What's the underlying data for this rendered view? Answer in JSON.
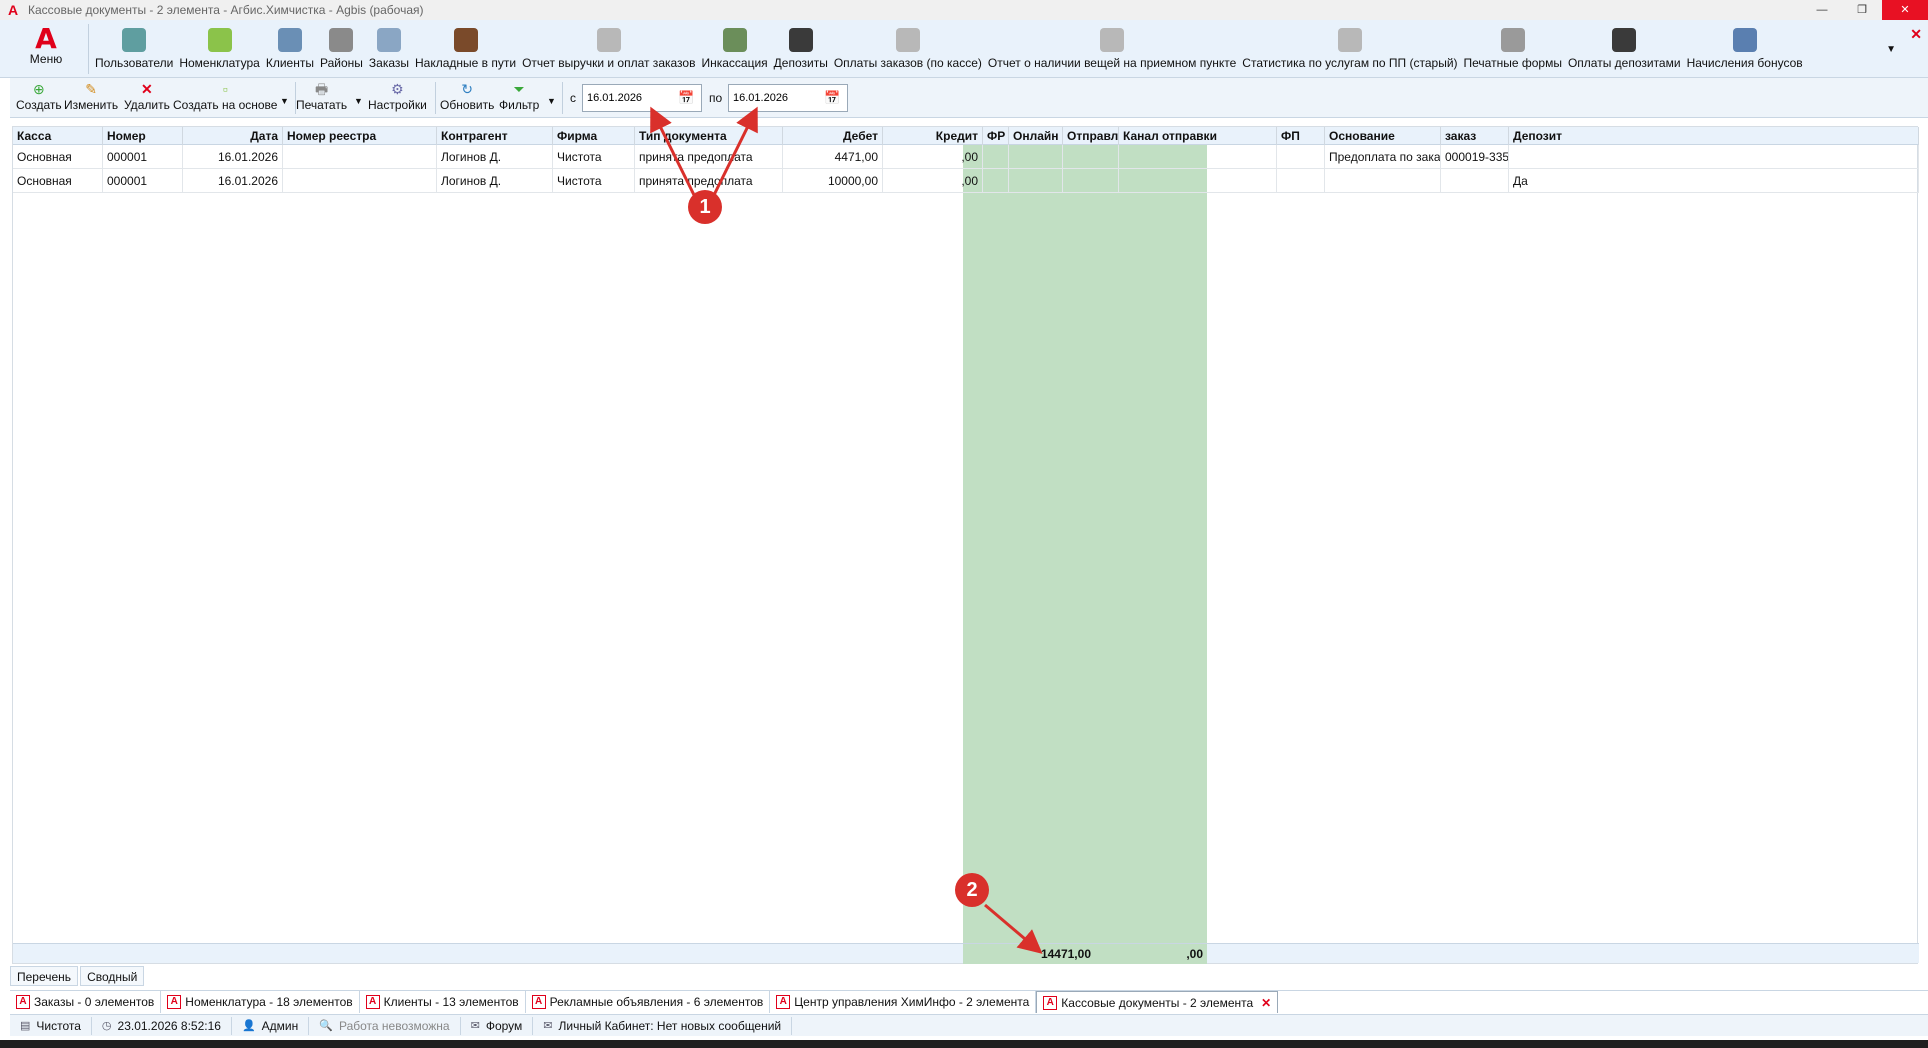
{
  "window": {
    "title": "Кассовые документы - 2 элемента - Агбис.Химчистка - Agbis (рабочая)"
  },
  "ribbon": {
    "menu_label": "Меню",
    "items": [
      {
        "label": "Пользователи",
        "icon": "users-icon",
        "color": "#5f9ea0"
      },
      {
        "label": "Номенклатура",
        "icon": "basket-icon",
        "color": "#8bc34a"
      },
      {
        "label": "Клиенты",
        "icon": "client-icon",
        "color": "#6a8fb5"
      },
      {
        "label": "Районы",
        "icon": "building-icon",
        "color": "#8a8a8a"
      },
      {
        "label": "Заказы",
        "icon": "orders-icon",
        "color": "#8aa6c4"
      },
      {
        "label": "Накладные в пути",
        "icon": "truck-icon",
        "color": "#7a4a2a"
      },
      {
        "label": "Отчет выручки и оплат заказов",
        "icon": "report-icon",
        "color": "#b8b8b8"
      },
      {
        "label": "Инкассация",
        "icon": "money-icon",
        "color": "#6b8e5a"
      },
      {
        "label": "Депозиты",
        "icon": "deposit-icon",
        "color": "#3a3a3a"
      },
      {
        "label": "Оплаты заказов (по кассе)",
        "icon": "report-icon",
        "color": "#b8b8b8"
      },
      {
        "label": "Отчет о наличии вещей на приемном пункте",
        "icon": "report-icon",
        "color": "#b8b8b8"
      },
      {
        "label": "Статистика по услугам по ПП (старый)",
        "icon": "report-icon",
        "color": "#b8b8b8"
      },
      {
        "label": "Печатные формы",
        "icon": "printer-icon",
        "color": "#9a9a9a"
      },
      {
        "label": "Оплаты депозитами",
        "icon": "deposit-icon",
        "color": "#3a3a3a"
      },
      {
        "label": "Начисления бонусов",
        "icon": "gift-icon",
        "color": "#5a7fb0"
      }
    ]
  },
  "toolbar": {
    "create": "Создать",
    "edit": "Изменить",
    "delete": "Удалить",
    "create_based": "Создать на основе",
    "print": "Печатать",
    "settings": "Настройки",
    "refresh": "Обновить",
    "filter": "Фильтр",
    "from_label": "с",
    "to_label": "по",
    "date_from": "16.01.2026",
    "date_to": "16.01.2026"
  },
  "grid": {
    "columns": [
      "Касса",
      "Номер",
      "Дата",
      "Номер реестра",
      "Контрагент",
      "Фирма",
      "Тип документа",
      "Дебет",
      "Кредит",
      "ФР",
      "Онлайн",
      "Отправл...",
      "Канал отправки",
      "ФП",
      "Основание",
      "заказ",
      "Депозит"
    ],
    "rows": [
      [
        "Основная",
        "000001",
        "16.01.2026",
        "",
        "Логинов Д.",
        "Чистота",
        "принята предоплата",
        "4471,00",
        ",00",
        "",
        "",
        "",
        "",
        "",
        "Предоплата по заказу",
        "000019-335",
        ""
      ],
      [
        "Основная",
        "000001",
        "16.01.2026",
        "",
        "Логинов Д.",
        "Чистота",
        "принята предоплата",
        "10000,00",
        ",00",
        "",
        "",
        "",
        "",
        "",
        "",
        "",
        "Да"
      ]
    ],
    "totals": {
      "debit": "14471,00",
      "credit": ",00"
    },
    "debit_highlight_color": "#c1dfc3"
  },
  "view_tabs": [
    "Перечень",
    "Сводный"
  ],
  "doc_tabs": [
    {
      "label": "Заказы - 0 элементов"
    },
    {
      "label": "Номенклатура - 18 элементов"
    },
    {
      "label": "Клиенты - 13 элементов"
    },
    {
      "label": "Рекламные объявления - 6 элементов"
    },
    {
      "label": "Центр управления ХимИнфо - 2 элемента"
    },
    {
      "label": "Кассовые документы - 2 элемента"
    }
  ],
  "status": {
    "firm": "Чистота",
    "datetime": "23.01.2026 8:52:16",
    "user": "Админ",
    "work_state": "Работа невозможна",
    "forum": "Форум",
    "cabinet": "Личный Кабинет: Нет новых сообщений"
  },
  "annotations": {
    "badge1": "1",
    "badge2": "2",
    "color": "#d9302b"
  }
}
